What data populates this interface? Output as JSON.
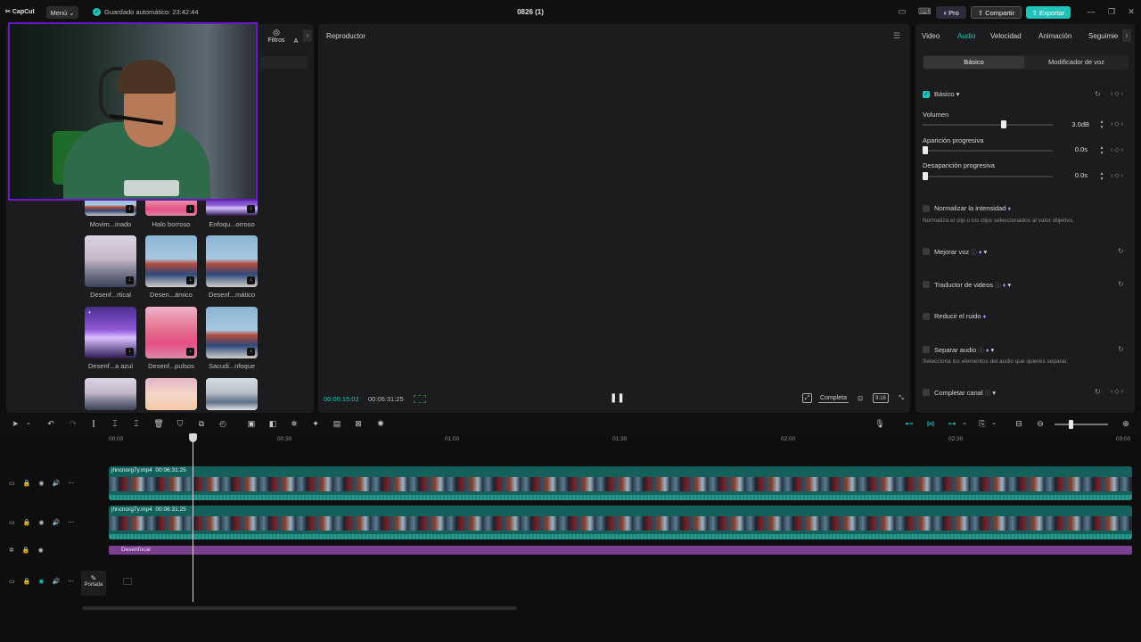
{
  "titlebar": {
    "app_name": "CapCut",
    "menu_label": "Menú",
    "autosave": "Guardado automático: 23:42:44",
    "project_name": "0826 (1)",
    "pro_label": "Pro",
    "share_label": "Compartir",
    "export_label": "Exportar"
  },
  "left_panel": {
    "tabs": [
      {
        "label": "Filtros"
      },
      {
        "label": "A"
      }
    ],
    "effects": [
      {
        "label": "Movim...inado"
      },
      {
        "label": "Halo borroso"
      },
      {
        "label": "Enfoqu...orroso"
      },
      {
        "label": "Desenf...rtical"
      },
      {
        "label": "Desen...ámico"
      },
      {
        "label": "Desenf...mático"
      },
      {
        "label": "Desenf...a azul"
      },
      {
        "label": "Desenf...pulsos"
      },
      {
        "label": "Sacudi...nfoque"
      }
    ]
  },
  "player": {
    "title": "Reproductor",
    "current_time": "00:00:15:02",
    "duration": "00:06:31:25",
    "quality": "Completa",
    "ratio": "9:16"
  },
  "right_panel": {
    "tabs": [
      {
        "label": "Video"
      },
      {
        "label": "Audio"
      },
      {
        "label": "Velocidad"
      },
      {
        "label": "Animación"
      },
      {
        "label": "Seguimie"
      }
    ],
    "segments": [
      "Básico",
      "Modificador de voz"
    ],
    "basic": {
      "section_label": "Básico",
      "volume_label": "Volumen",
      "volume_value": "3.0dB",
      "volume_level": 0.62,
      "fade_in_label": "Aparición progresiva",
      "fade_in_value": "0.0s",
      "fade_out_label": "Desaparición progresiva",
      "fade_out_value": "0.0s"
    },
    "options": [
      {
        "label": "Normalizar la intensidad",
        "desc": "Normaliza el clip o los clips seleccionados al valor objetivo."
      },
      {
        "label": "Mejorar voz"
      },
      {
        "label": "Traductor de videos"
      },
      {
        "label": "Reducir el ruido"
      },
      {
        "label": "Separar audio",
        "desc": "Selecciona los elementos del audio que quieres separar."
      },
      {
        "label": "Completar canal"
      }
    ]
  },
  "timeline": {
    "ruler": [
      "00:00",
      "00:30",
      "01:00",
      "01:30",
      "02:00",
      "02:30",
      "03:00"
    ],
    "clips": [
      {
        "name": "jhncnorg7y.mp4",
        "duration": "00:06:31:25"
      },
      {
        "name": "jhncnorg7y.mp4",
        "duration": "00:06:31:25"
      }
    ],
    "effect_clip": "Desenfocar",
    "cover_label": "Portada"
  },
  "colors": {
    "accent": "#20c2ba",
    "webcam_border": "#6b16c9",
    "effect_clip": "#7a3f8f"
  }
}
